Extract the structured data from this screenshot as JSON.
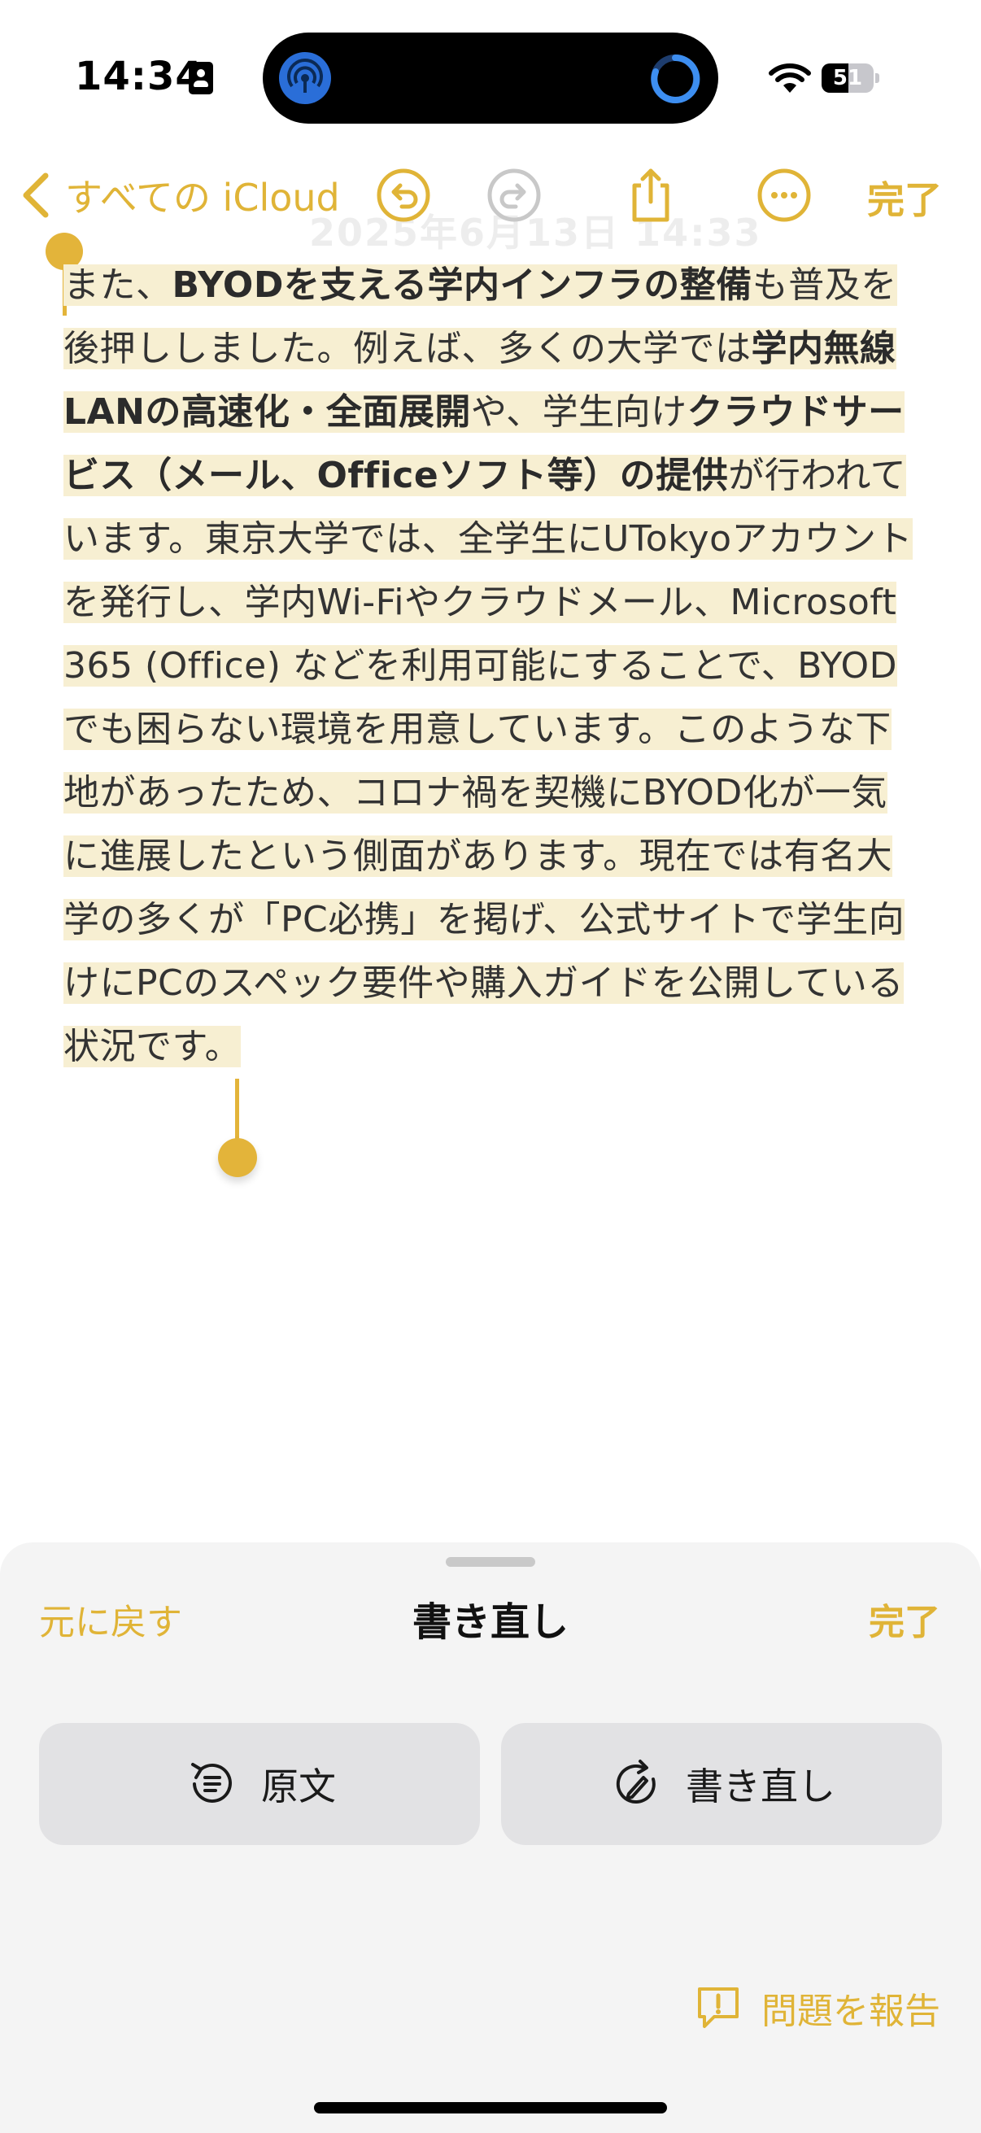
{
  "status": {
    "time": "14:34",
    "battery": "51",
    "battery_level": 0.51
  },
  "nav": {
    "back_label": "すべての iCloud",
    "done_label": "完了",
    "ghost_title": "2025年6月13日 14:33"
  },
  "note": {
    "segments": [
      {
        "t": "また、",
        "b": false
      },
      {
        "t": "BYODを支える学内インフラの整備",
        "b": true
      },
      {
        "t": "も普及を後押ししました。例えば、多くの大学では",
        "b": false
      },
      {
        "t": "学内無線LANの高速化・全面展開",
        "b": true
      },
      {
        "t": "や、学生向け",
        "b": false
      },
      {
        "t": "クラウドサービス（メール、Officeソフト等）の提供",
        "b": true
      },
      {
        "t": "が行われています。東京大学では、全学生にUTokyoアカウントを発行し、学内Wi‑Fiやクラウドメール、Microsoft 365 (Office) などを利用可能にすることで、BYODでも困らない環境を用意しています。このような下地があったため、コロナ禍を契機にBYOD化が一気に進展したという側面があります。現在では有名大学の多くが「PC必携」を掲げ、公式サイトで学生向けにPCのスペック要件や購入ガイドを公開している状況です。",
        "b": false
      }
    ]
  },
  "sheet": {
    "undo_label": "元に戻す",
    "title": "書き直し",
    "done_label": "完了",
    "original_label": "原文",
    "rewrite_label": "書き直し",
    "report_label": "問題を報告"
  },
  "colors": {
    "accent": "#e0b437",
    "selection": "#f7efd2",
    "sheet_bg": "#f4f4f4",
    "option_bg": "#e2e2e4"
  }
}
